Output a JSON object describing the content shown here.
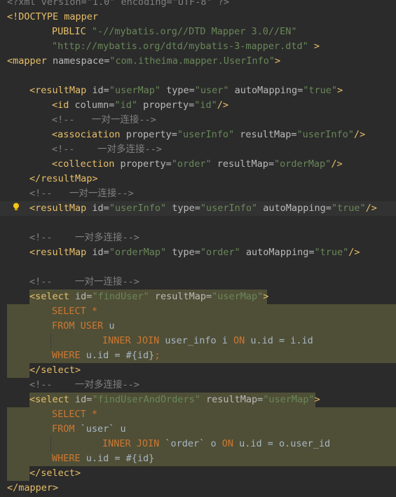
{
  "editor": {
    "language": "XML",
    "line_prolog": "<?xml version=\"1.0\" encoding=\"UTF-8\" ?>",
    "doctype_open": "<!DOCTYPE mapper",
    "doctype_public": "PUBLIC",
    "doctype_public_id": "\"-//mybatis.org//DTD Mapper 3.0//EN\"",
    "doctype_system": "\"http://mybatis.org/dtd/mybatis-3-mapper.dtd\"",
    "doctype_close": ">",
    "mapper_open_tag": "<mapper",
    "namespace_attr": "namespace=",
    "namespace_val": "\"com.itheima.mapper.UserInfo\"",
    "gt": ">",
    "rm_tag": "<resultMap",
    "rm_id_attr": "id=",
    "rm_id_val": "\"userMap\"",
    "rm_type_attr": "type=",
    "rm_type_val": "\"user\"",
    "rm_am_attr": "autoMapping=",
    "rm_am_val": "\"true\"",
    "id_tag": "<id",
    "id_col_attr": "column=",
    "id_col_val": "\"id\"",
    "id_prop_attr": "property=",
    "id_prop_val": "\"id\"",
    "self_close": "/>",
    "comment_one": "<!--   一对一连接-->",
    "comment_one_b": "<!--    一对一连接-->",
    "assoc_tag": "<association",
    "assoc_prop_attr": "property=",
    "assoc_prop_val": "\"userInfo\"",
    "assoc_rm_attr": "resultMap=",
    "assoc_rm_val": "\"userInfo\"",
    "comment_many": "<!--    一对多连接-->",
    "coll_tag": "<collection",
    "coll_prop_attr": "property=",
    "coll_prop_val": "\"order\"",
    "coll_rm_attr": "resultMap=",
    "coll_rm_val": "\"orderMap\"",
    "rm_close": "</resultMap>",
    "rm2_id_val": "\"userInfo\"",
    "rm2_type_val": "\"userInfo\"",
    "rm3_id_val": "\"orderMap\"",
    "rm3_type_val": "\"order\"",
    "sel_tag": "<select",
    "sel_id_attr": "id=",
    "sel1_id_val": "\"findUser\"",
    "sel_rm_attr": "resultMap=",
    "sel_rm_val": "\"userMap\"",
    "sql_select": "SELECT",
    "sql_star": "*",
    "sql_from": "FROM",
    "sql_user_kw": "USER",
    "sql_u": "u",
    "sql_inner_join": "INNER JOIN",
    "sql_user_info": "user_info i",
    "sql_on": "ON",
    "sql_cond1": "u.id = i.id",
    "sql_where": "WHERE",
    "sql_where_cond": "u.id = #{id}",
    "semicolon": ";",
    "sel_close": "</select>",
    "sel2_id_val": "\"findUserAndOrders\"",
    "sql_user_bt": "`user` u",
    "sql_order_bt": "`order` o",
    "sql_cond2": "u.id = o.user_id",
    "mapper_close": "</mapper>"
  },
  "colors": {
    "background": "#2b2b2b",
    "tag": "#e8bf6a",
    "attribute": "#bababa",
    "value": "#6a8759",
    "comment": "#808080",
    "keyword": "#cc7832",
    "text": "#a9b7c6",
    "sql_highlight": "#4f4f37",
    "bulb": "#f5c518"
  },
  "icons": {
    "intention": "lightbulb-icon"
  }
}
